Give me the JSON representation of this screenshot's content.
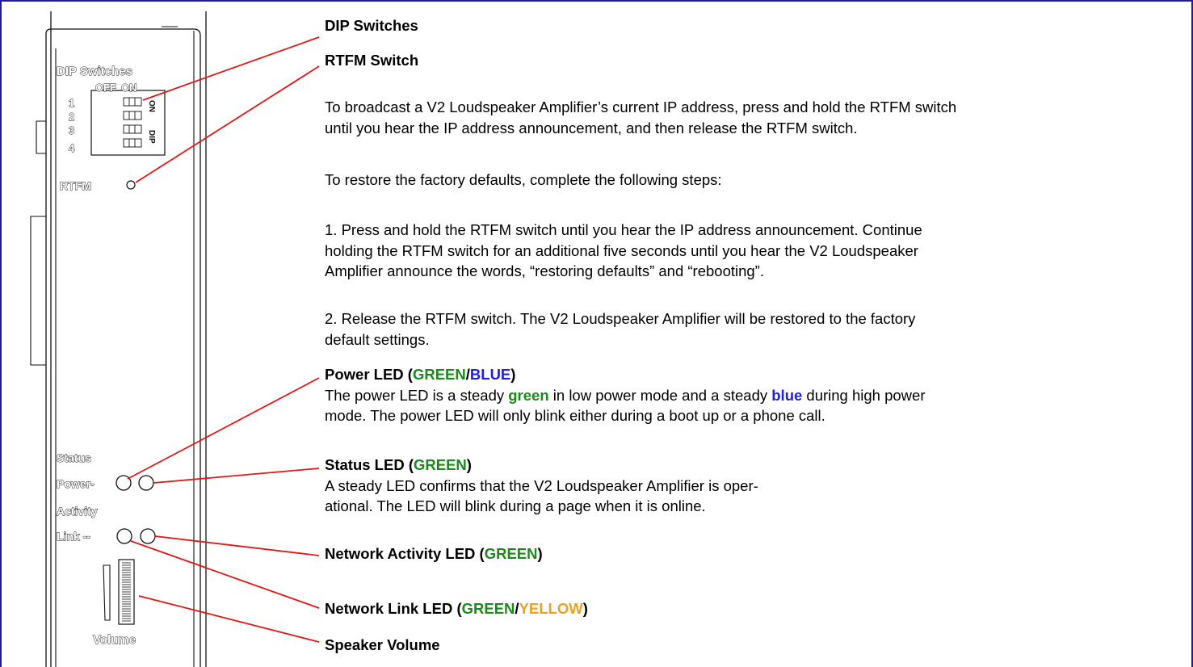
{
  "device": {
    "dip_title": "DIP Switches",
    "off_label": "OFF",
    "on_label": "ON",
    "switch_numbers": [
      "1",
      "2",
      "3",
      "4"
    ],
    "dip_on_mark": "ON",
    "dip_mark": "DIP",
    "rtfm_label": "RTFM",
    "status_label": "Status",
    "power_label": "Power-",
    "activity_label": "Activity",
    "link_label": "Link --",
    "volume_label": "Volume"
  },
  "callouts": {
    "dip": {
      "title": "DIP Switches"
    },
    "rtfm": {
      "title": "RTFM Switch",
      "para1_line1": "To broadcast a V2 Loudspeaker Amplifier’s current IP address, press and hold the RTFM switch",
      "para1_line2": "until you hear the IP address announcement, and then release the RTFM switch.",
      "para2": "To restore the factory defaults, complete the following steps:",
      "step1_line1": "1. Press and hold the RTFM switch until you hear the IP address announcement. Continue",
      "step1_line2": "holding the RTFM switch for an additional five seconds until you hear the V2 Loudspeaker",
      "step1_line3": "Amplifier announce the words, “restoring defaults” and “rebooting”.",
      "step2_line1": "2. Release the RTFM switch. The V2 Loudspeaker Amplifier will be restored to the factory",
      "step2_line2": "default settings."
    },
    "power": {
      "title_prefix": "Power LED (",
      "title_green": "GREEN",
      "title_slash": "/",
      "title_blue": "BLUE",
      "title_suffix": ")",
      "line1_a": "The power LED is a steady ",
      "line1_green": "green",
      "line1_b": " in low power mode and a steady ",
      "line1_blue": "blue",
      "line1_c": " during high power",
      "line2": "mode. The power LED will only blink either during a boot up or a phone call."
    },
    "status": {
      "title_prefix": "Status LED (",
      "title_green": "GREEN",
      "title_suffix": ")",
      "line1": "A steady LED confirms that the V2 Loudspeaker Amplifier is oper-",
      "line2": "ational. The LED will blink during a page when it is online."
    },
    "activity": {
      "title_prefix": "Network Activity LED (",
      "title_green": "GREEN",
      "title_suffix": ")"
    },
    "link": {
      "title_prefix": "Network Link LED (",
      "title_green": "GREEN",
      "title_slash": "/",
      "title_yellow": "YELLOW",
      "title_suffix": ")"
    },
    "volume": {
      "title": "Speaker Volume"
    }
  },
  "colors": {
    "callout_line": "#e01818",
    "green": "#1a8a1a",
    "blue": "#1d1df0",
    "yellow": "#f0a020",
    "frame": "#1f1f8f"
  }
}
